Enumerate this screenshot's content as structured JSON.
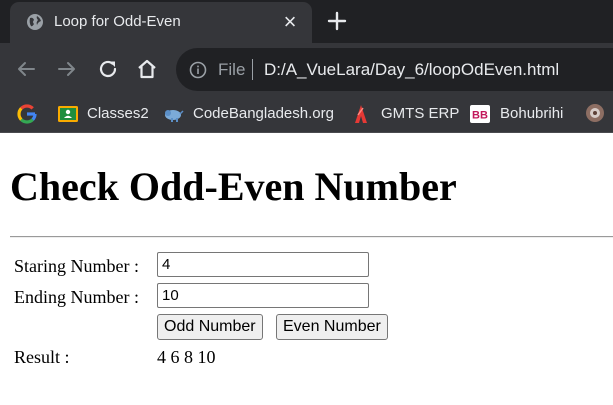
{
  "browser": {
    "tab": {
      "title": "Loop for Odd-Even",
      "favicon": "globe-icon"
    },
    "address": {
      "scheme": "File",
      "url": "D:/A_VueLara/Day_6/loopOdEven.html"
    },
    "bookmarks": [
      {
        "label": "",
        "icon": "google-icon"
      },
      {
        "label": "Classes2",
        "icon": "classroom-icon"
      },
      {
        "label": "CodeBangladesh.org",
        "icon": "codebangladesh-icon"
      },
      {
        "label": "GMTS ERP",
        "icon": "gmts-icon"
      },
      {
        "label": "Bohubrihi",
        "icon": "bohubrihi-icon"
      }
    ]
  },
  "page": {
    "title": "Check Odd-Even Number",
    "start_label": "Staring Number :",
    "start_value": "4",
    "end_label": "Ending Number :",
    "end_value": "10",
    "odd_button": "Odd Number",
    "even_button": "Even Number",
    "result_label": "Result :",
    "result_value": "4 6 8 10"
  }
}
